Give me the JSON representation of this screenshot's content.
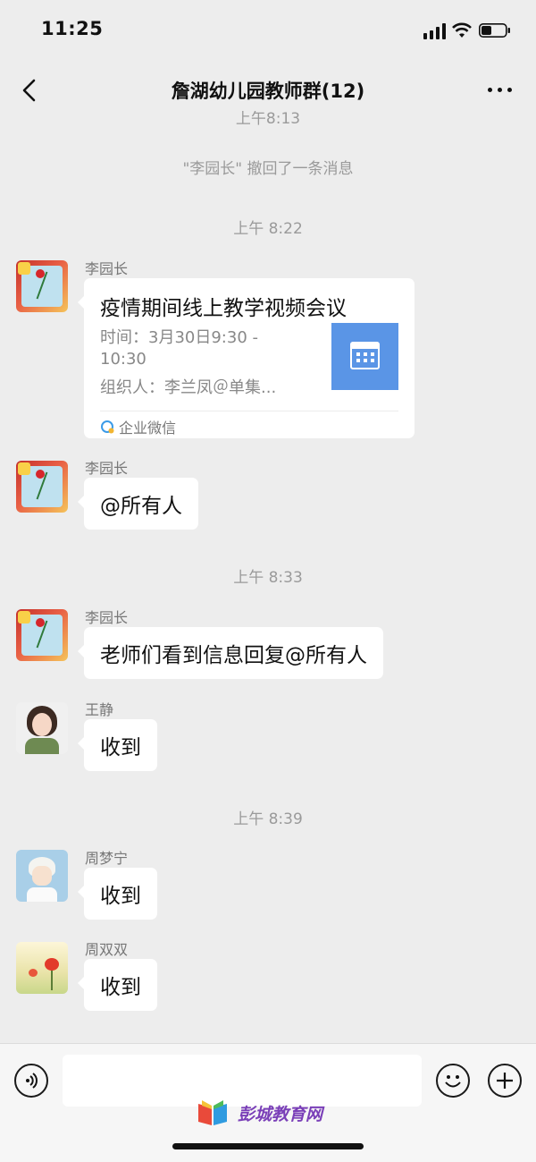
{
  "status": {
    "time": "11:25"
  },
  "nav": {
    "title": "詹湖幼儿园教师群(12)",
    "back_icon": "chevron-left-icon",
    "more_icon": "more-dots-icon"
  },
  "messages": {
    "top_time_partial": "上午8:13",
    "recall_notice": "\"李园长\" 撤回了一条消息",
    "time1": "上午 8:22",
    "sender1": "李园长",
    "meeting": {
      "title": "疫情期间线上教学视频会议",
      "time_line1": "时间：3月30日9:30 -",
      "time_line2": "10:30",
      "organizer": "组织人：李兰凤＠单集...",
      "source": "企业微信"
    },
    "sender2": "李园长",
    "msg2": "@所有人",
    "time2": "上午 8:33",
    "sender3": "李园长",
    "msg3": "老师们看到信息回复@所有人",
    "sender4": "王静",
    "msg4": "收到",
    "time3": "上午 8:39",
    "sender5": "周梦宁",
    "msg5": "收到",
    "sender6": "周双双",
    "msg6": "收到"
  },
  "input": {
    "placeholder": ""
  },
  "watermark": {
    "text": "彭城教育网"
  },
  "colors": {
    "background": "#ededed",
    "bubble": "#ffffff",
    "calendar": "#5a95e6",
    "watermark": "#7a3fb8"
  }
}
